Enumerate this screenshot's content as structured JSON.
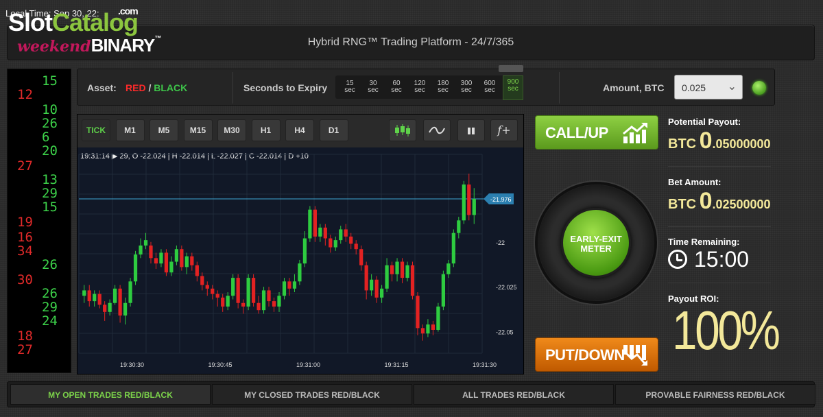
{
  "header": {
    "local_time": "Local Time: Sep 30, 22:",
    "watermark_slot": "Slot",
    "watermark_catalog": "Catalog",
    "watermark_com": ".com",
    "brand_weekend": "weekend",
    "brand_binary": "BINARY",
    "brand_tm": "™",
    "platform_title": "Hybrid RNG™ Trading Platform - 24/7/365"
  },
  "ticker": {
    "green": [
      "15",
      "10",
      "26",
      "6",
      "20",
      "13",
      "29",
      "15",
      "26",
      "26",
      "29",
      "24"
    ],
    "red": [
      "12",
      "27",
      "19",
      "16",
      "34",
      "30",
      "18",
      "27"
    ]
  },
  "controls": {
    "asset_label": "Asset:",
    "asset_red": "RED",
    "asset_sep": " / ",
    "asset_black": "BLACK",
    "expiry_label": "Seconds to Expiry",
    "expiry_options": [
      {
        "value": "15",
        "unit": "sec"
      },
      {
        "value": "30",
        "unit": "sec"
      },
      {
        "value": "60",
        "unit": "sec"
      },
      {
        "value": "120",
        "unit": "sec"
      },
      {
        "value": "180",
        "unit": "sec"
      },
      {
        "value": "300",
        "unit": "sec"
      },
      {
        "value": "600",
        "unit": "sec"
      },
      {
        "value": "900",
        "unit": "sec"
      }
    ],
    "expiry_selected": "900",
    "amount_label": "Amount, BTC",
    "amount_value": "0.025"
  },
  "chart_toolbar": {
    "timeframes": [
      "TICK",
      "M1",
      "M5",
      "M15",
      "M30",
      "H1",
      "H4",
      "D1"
    ],
    "active_timeframe": "TICK",
    "tools": [
      "candlestick-icon",
      "line-icon",
      "bar-icon",
      "function-icon"
    ],
    "function_label": "f+"
  },
  "ohlc_text": "19:31:14 ▶ 29, O -22.024 | H -22.014 | L -22.027 | C -22.014 | D +10",
  "chart_data": {
    "type": "candlestick",
    "x_ticks": [
      "19:30:30",
      "19:30:45",
      "19:31:00",
      "19:31:15",
      "19:31:30"
    ],
    "y_ticks": [
      "-22",
      "-22.025",
      "-22.05"
    ],
    "price_line": "-21.976",
    "colors": {
      "up": "#2ecc40",
      "down": "#e32222",
      "price_line": "#3fa9d6"
    },
    "candles": [
      [
        -22.03,
        -22.027,
        -22.024,
        -22.034
      ],
      [
        -22.027,
        -22.033,
        -22.024,
        -22.036
      ],
      [
        -22.033,
        -22.029,
        -22.027,
        -22.036
      ],
      [
        -22.029,
        -22.035,
        -22.027,
        -22.037
      ],
      [
        -22.035,
        -22.039,
        -22.033,
        -22.044
      ],
      [
        -22.039,
        -22.034,
        -22.032,
        -22.041
      ],
      [
        -22.034,
        -22.026,
        -22.024,
        -22.035
      ],
      [
        -22.026,
        -22.041,
        -22.024,
        -22.045
      ],
      [
        -22.041,
        -22.034,
        -22.031,
        -22.046
      ],
      [
        -22.034,
        -22.022,
        -22.02,
        -22.036
      ],
      [
        -22.022,
        -22.007,
        -22.005,
        -22.024
      ],
      [
        -22.007,
        -22.002,
        -21.998,
        -22.009
      ],
      [
        -22.002,
        -21.999,
        -21.995,
        -22.004
      ],
      [
        -22.002,
        -22.009,
        -22.0,
        -22.012
      ],
      [
        -22.009,
        -22.012,
        -22.006,
        -22.015
      ],
      [
        -22.012,
        -22.006,
        -22.004,
        -22.014
      ],
      [
        -22.006,
        -22.017,
        -22.004,
        -22.019
      ],
      [
        -22.017,
        -22.011,
        -22.008,
        -22.019
      ],
      [
        -22.011,
        -22.004,
        -22.002,
        -22.013
      ],
      [
        -22.004,
        -22.014,
        -22.002,
        -22.016
      ],
      [
        -22.014,
        -22.008,
        -22.006,
        -22.018
      ],
      [
        -22.008,
        -22.013,
        -22.006,
        -22.016
      ],
      [
        -22.013,
        -22.019,
        -22.011,
        -22.022
      ],
      [
        -22.019,
        -22.024,
        -22.017,
        -22.027
      ],
      [
        -22.024,
        -22.026,
        -22.022,
        -22.03
      ],
      [
        -22.026,
        -22.029,
        -22.024,
        -22.032
      ],
      [
        -22.029,
        -22.031,
        -22.027,
        -22.036
      ],
      [
        -22.031,
        -22.036,
        -22.029,
        -22.039
      ],
      [
        -22.036,
        -22.03,
        -22.028,
        -22.038
      ],
      [
        -22.03,
        -22.02,
        -22.018,
        -22.032
      ],
      [
        -22.02,
        -22.034,
        -22.018,
        -22.037
      ],
      [
        -22.034,
        -22.036,
        -22.032,
        -22.04
      ],
      [
        -22.036,
        -22.02,
        -22.018,
        -22.038
      ],
      [
        -22.02,
        -22.034,
        -22.018,
        -22.036
      ],
      [
        -22.034,
        -22.038,
        -22.03,
        -22.04
      ],
      [
        -22.038,
        -22.027,
        -22.025,
        -22.04
      ],
      [
        -22.027,
        -22.033,
        -22.025,
        -22.036
      ],
      [
        -22.033,
        -22.036,
        -22.031,
        -22.039
      ],
      [
        -22.036,
        -22.03,
        -22.028,
        -22.039
      ],
      [
        -22.03,
        -22.022,
        -22.02,
        -22.032
      ],
      [
        -22.022,
        -22.026,
        -22.02,
        -22.03
      ],
      [
        -22.026,
        -22.022,
        -22.018,
        -22.028
      ],
      [
        -22.022,
        -22.012,
        -22.01,
        -22.024
      ],
      [
        -22.012,
        -21.998,
        -21.994,
        -22.014
      ],
      [
        -21.998,
        -21.982,
        -21.98,
        -22.0
      ],
      [
        -21.982,
        -21.997,
        -21.98,
        -22.0
      ],
      [
        -21.997,
        -21.992,
        -21.99,
        -22.0
      ],
      [
        -21.992,
        -21.998,
        -21.99,
        -22.002
      ],
      [
        -21.998,
        -22.003,
        -21.996,
        -22.006
      ],
      [
        -22.003,
        -21.999,
        -21.997,
        -22.005
      ],
      [
        -21.999,
        -21.993,
        -21.991,
        -22.001
      ],
      [
        -21.993,
        -21.997,
        -21.99,
        -22.0
      ],
      [
        -21.997,
        -22.001,
        -21.995,
        -22.004
      ],
      [
        -22.001,
        -22.004,
        -21.999,
        -22.007
      ],
      [
        -22.004,
        -22.013,
        -22.002,
        -22.016
      ],
      [
        -22.013,
        -22.027,
        -22.011,
        -22.032
      ],
      [
        -22.027,
        -22.021,
        -22.018,
        -22.03
      ],
      [
        -22.021,
        -22.031,
        -22.019,
        -22.034
      ],
      [
        -22.031,
        -22.026,
        -22.024,
        -22.034
      ],
      [
        -22.026,
        -22.013,
        -22.009,
        -22.028
      ],
      [
        -22.013,
        -22.018,
        -22.011,
        -22.022
      ],
      [
        -22.018,
        -22.011,
        -22.009,
        -22.022
      ],
      [
        -22.011,
        -22.02,
        -22.009,
        -22.023
      ],
      [
        -22.02,
        -22.013,
        -22.011,
        -22.022
      ],
      [
        -22.013,
        -22.03,
        -22.011,
        -22.032
      ],
      [
        -22.03,
        -22.048,
        -22.028,
        -22.052
      ],
      [
        -22.048,
        -22.051,
        -22.046,
        -22.055
      ],
      [
        -22.051,
        -22.046,
        -22.043,
        -22.053
      ],
      [
        -22.046,
        -22.049,
        -22.044,
        -22.052
      ],
      [
        -22.049,
        -22.036,
        -22.034,
        -22.05
      ],
      [
        -22.036,
        -22.018,
        -22.016,
        -22.038
      ],
      [
        -22.018,
        -22.012,
        -22.01,
        -22.02
      ],
      [
        -22.012,
        -21.995,
        -21.993,
        -22.014
      ],
      [
        -21.995,
        -21.988,
        -21.986,
        -21.998
      ],
      [
        -21.988,
        -21.968,
        -21.966,
        -21.99
      ],
      [
        -21.968,
        -21.985,
        -21.962,
        -21.988
      ],
      [
        -21.985,
        -21.976,
        -21.97,
        -21.99
      ]
    ]
  },
  "buttons": {
    "call": "CALL/UP",
    "put": "PUT/DOWN",
    "meter_line1": "EARLY-EXIT",
    "meter_line2": "METER"
  },
  "info": {
    "payout_label": "Potential Payout:",
    "payout_currency": "BTC",
    "payout_int": "0",
    "payout_dec": ".05000000",
    "bet_label": "Bet Amount:",
    "bet_currency": "BTC",
    "bet_int": "0",
    "bet_dec": ".02500000",
    "time_label": "Time Remaining:",
    "time_value": "15:00",
    "roi_label": "Payout ROI:",
    "roi_value": "100%"
  },
  "tabs": [
    "MY OPEN TRADES RED/BLACK",
    "MY CLOSED TRADES RED/BLACK",
    "ALL TRADES RED/BLACK",
    "PROVABLE FAIRNESS RED/BLACK"
  ]
}
